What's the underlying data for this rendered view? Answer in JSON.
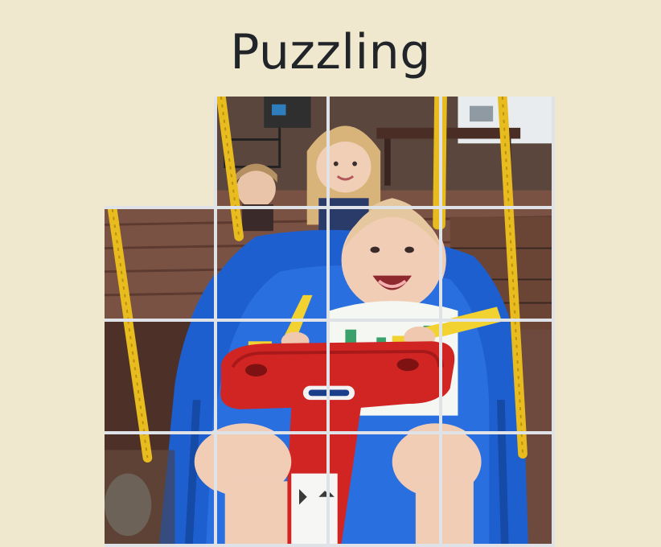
{
  "header": {
    "title": "Puzzling"
  },
  "puzzle": {
    "grid_size": 4,
    "empty_tile": 0,
    "tiles": [
      {
        "name": "puzzle-tile-1"
      },
      {
        "name": "puzzle-tile-2"
      },
      {
        "name": "puzzle-tile-3"
      },
      {
        "name": "puzzle-tile-4"
      },
      {
        "name": "puzzle-tile-5"
      },
      {
        "name": "puzzle-tile-6"
      },
      {
        "name": "puzzle-tile-7"
      },
      {
        "name": "puzzle-tile-8"
      },
      {
        "name": "puzzle-tile-9"
      },
      {
        "name": "puzzle-tile-10"
      },
      {
        "name": "puzzle-tile-11"
      },
      {
        "name": "puzzle-tile-12"
      },
      {
        "name": "puzzle-tile-13"
      },
      {
        "name": "puzzle-tile-14"
      },
      {
        "name": "puzzle-tile-15"
      },
      {
        "name": "puzzle-tile-16"
      }
    ]
  },
  "colors": {
    "background": "#efe8ce",
    "title": "#212529",
    "grid_lines": "#dfe2e6"
  }
}
